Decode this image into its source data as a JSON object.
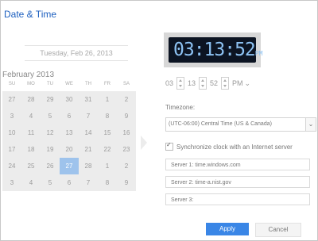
{
  "window": {
    "title": "Date & Time"
  },
  "calendar": {
    "selected_date_text": "Tuesday, Feb 26, 2013",
    "month_label": "February 2013",
    "weekdays": [
      "SU",
      "MO",
      "TU",
      "WE",
      "TH",
      "FR",
      "SA"
    ],
    "days": [
      "27",
      "28",
      "29",
      "30",
      "31",
      "1",
      "2",
      "3",
      "4",
      "5",
      "6",
      "7",
      "8",
      "9",
      "10",
      "11",
      "12",
      "13",
      "14",
      "15",
      "16",
      "17",
      "18",
      "19",
      "20",
      "21",
      "22",
      "23",
      "24",
      "25",
      "26",
      "27",
      "28",
      "1",
      "2",
      "3",
      "4",
      "5",
      "6",
      "7",
      "8",
      "9"
    ],
    "selected_day": "26"
  },
  "clock": {
    "display": "03:13:52",
    "ampm": "PM"
  },
  "time_spinners": {
    "hour": "03",
    "minute": "13",
    "second": "52",
    "ampm": "PM"
  },
  "timezone": {
    "label": "Timezone:",
    "value": "(UTC-06:00) Central Time (US & Canada)"
  },
  "sync": {
    "label": "Synchronize clock with an Internet server"
  },
  "servers": [
    {
      "label": "Server 1:",
      "value": "time.windows.com"
    },
    {
      "label": "Server 2:",
      "value": "time-a.nist.gov"
    },
    {
      "label": "Server 3:",
      "value": ""
    }
  ],
  "buttons": {
    "apply": "Apply",
    "cancel": "Cancel"
  },
  "colors": {
    "accent": "#3a86e6",
    "selection": "#9ec3ec",
    "clock_digits": "#8dc2f2"
  }
}
